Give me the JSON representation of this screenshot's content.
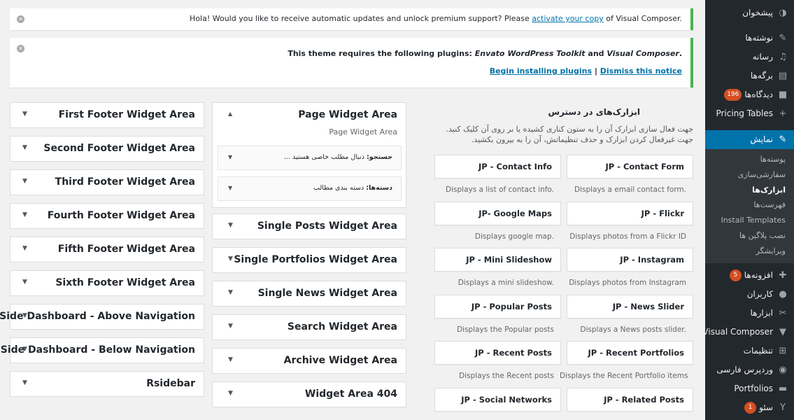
{
  "sidebar": {
    "items_top": [
      {
        "label": "پیشخوان",
        "icon": "dashboard-icon",
        "glyph": "◑"
      },
      {
        "label": "نوشته‌ها",
        "icon": "pin-icon",
        "glyph": "✎"
      },
      {
        "label": "رسانه",
        "icon": "media-icon",
        "glyph": "♫"
      },
      {
        "label": "برگه‌ها",
        "icon": "pages-icon",
        "glyph": "▤"
      },
      {
        "label": "دیدگاه‌ها",
        "icon": "comments-icon",
        "glyph": "■",
        "badge": "196"
      },
      {
        "label": "Pricing Tables",
        "icon": "plus-icon",
        "glyph": "+"
      }
    ],
    "current": {
      "label": "نمایش",
      "icon": "brush-icon",
      "glyph": "✎"
    },
    "submenu": [
      "پوسته‌ها",
      "سفارشی‌سازی",
      "ابزارک‌ها",
      "فهرست‌ها",
      "Install Templates",
      "نصب پلاگین ها",
      "ویرایشگر"
    ],
    "submenu_active_index": 2,
    "items_bottom": [
      {
        "label": "افزونه‌ها",
        "icon": "plugins-icon",
        "glyph": "✚",
        "badge": "5"
      },
      {
        "label": "کاربران",
        "icon": "users-icon",
        "glyph": "●"
      },
      {
        "label": "ابزارها",
        "icon": "tools-icon",
        "glyph": "✂"
      },
      {
        "label": "Visual Composer",
        "icon": "visual-composer-icon",
        "glyph": "▼"
      },
      {
        "label": "تنظیمات",
        "icon": "settings-icon",
        "glyph": "⊞"
      },
      {
        "label": "وردپرس فارسی",
        "icon": "wp-farsi-icon",
        "glyph": "◉"
      },
      {
        "label": "Portfolios",
        "icon": "portfolios-icon",
        "glyph": "▬"
      },
      {
        "label": "سئو",
        "icon": "seo-icon",
        "glyph": "Y",
        "badge": "1"
      }
    ]
  },
  "notice1": {
    "text_before": "Hola! Would you like to receive automatic updates and unlock premium support? Please ",
    "link": "activate your copy",
    "text_after": " of Visual Composer."
  },
  "notice2": {
    "line1_prefix": "This theme requires the following plugins: ",
    "plugin1": "Envato WordPress Toolkit",
    "and": " and ",
    "plugin2": "Visual Composer",
    "suffix": ".",
    "link_install": "Begin installing plugins",
    "separator": "|",
    "link_dismiss": "Dismiss this notice"
  },
  "available": {
    "title": "ابزارک‌های در دسترس",
    "description": "جهت فعال سازی ابزارک آن را به ستون کناری کشیده یا بر روی آن کلیک کنید. جهت غیرفعال کردن ابزارک و حذف تنظیماتش، آن را به بیرون بکشید."
  },
  "widgets": [
    {
      "title": "JP - Contact Form",
      "desc": "Displays a email contact form."
    },
    {
      "title": "JP - Contact Info",
      "desc": "Displays a list of contact info."
    },
    {
      "title": "JP - Flickr",
      "desc": "Displays photos from a Flickr ID"
    },
    {
      "title": "JP- Google Maps",
      "desc": "Displays google map."
    },
    {
      "title": "JP - Instagram",
      "desc": "Displays photos from Instagram"
    },
    {
      "title": "JP - Mini Slideshow",
      "desc": "Displays a mini slideshow."
    },
    {
      "title": "JP - News Slider",
      "desc": "Displays a News posts slider."
    },
    {
      "title": "JP - Popular Posts",
      "desc": "Displays the Popular posts"
    },
    {
      "title": "JP - Recent Portfolios",
      "desc": "Displays the Recent Portfolio items"
    },
    {
      "title": "JP - Recent Posts",
      "desc": "Displays the Recent posts"
    },
    {
      "title": "JP - Related Posts",
      "desc": ""
    },
    {
      "title": "JP - Social Networks",
      "desc": ""
    }
  ],
  "page_widget_area": {
    "title": "Page Widget Area",
    "description": "Page Widget Area",
    "inner": [
      {
        "label": "جستجو:",
        "value": "دنبال مطلب خاصی هستید ..."
      },
      {
        "label": "دسته‌ها:",
        "value": "دسته بندی مطالب"
      }
    ]
  },
  "middle_sidebars": [
    "Single Posts Widget Area",
    "Single Portfolios Widget Area",
    "Single News Widget Area",
    "Search Widget Area",
    "Archive Widget Area",
    "Widget Area 404"
  ],
  "left_sidebars": [
    "First Footer Widget Area",
    "Second Footer Widget Area",
    "Third Footer Widget Area",
    "Fourth Footer Widget Area",
    "Fifth Footer Widget Area",
    "Sixth Footer Widget Area",
    "Side Dashboard - Above Navigation",
    "Side Dashboard - Below Navigation",
    "Rsidebar"
  ]
}
